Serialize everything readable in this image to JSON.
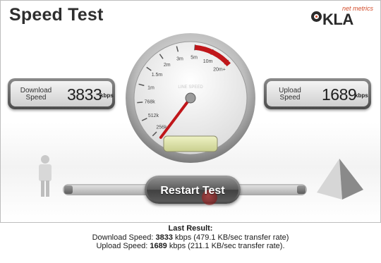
{
  "app": {
    "title": "Speed Test",
    "logo": {
      "tagline": "net metrics",
      "word": "KLA",
      "brand_color": "#d24b2a"
    }
  },
  "download": {
    "label_line1": "Download",
    "label_line2": "Speed",
    "value": "3833",
    "unit": "kbps"
  },
  "upload": {
    "label_line1": "Upload",
    "label_line2": "Speed",
    "value": "1689",
    "unit": "kbps"
  },
  "gauge": {
    "caption": "LINE SPEED",
    "tick_labels": [
      "256k",
      "512k",
      "768k",
      "1m",
      "1.5m",
      "2m",
      "3m",
      "5m",
      "10m",
      "20m+"
    ],
    "needle_value": "256k",
    "accent_color": "#c0161a"
  },
  "controls": {
    "restart_label": "Restart Test"
  },
  "last_result": {
    "heading": "Last Result:",
    "download_prefix": "Download Speed: ",
    "download_value": "3833",
    "download_suffix": " kbps (479.1 KB/sec transfer rate)",
    "upload_prefix": "Upload Speed: ",
    "upload_value": "1689",
    "upload_suffix": " kbps (211.1 KB/sec transfer rate)."
  },
  "icons": {
    "left": "person-icon",
    "right": "server-pyramid-icon"
  }
}
